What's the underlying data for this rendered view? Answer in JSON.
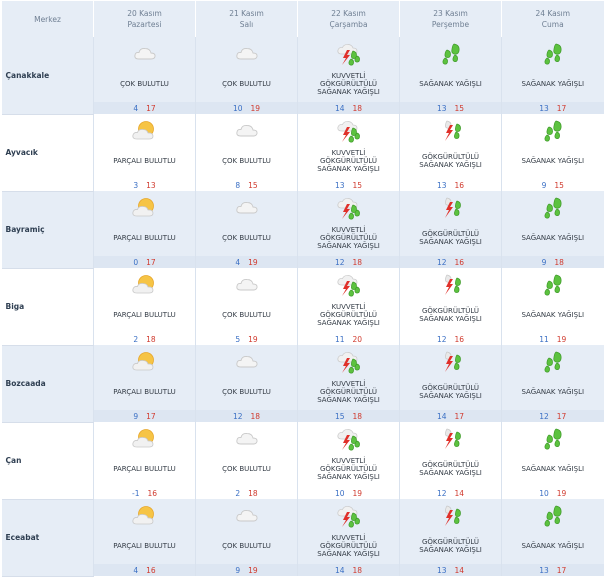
{
  "header": {
    "merkez": "Merkez",
    "days": [
      {
        "date": "20 Kasım",
        "weekday": "Pazartesi"
      },
      {
        "date": "21 Kasım",
        "weekday": "Salı"
      },
      {
        "date": "22 Kasım",
        "weekday": "Çarşamba"
      },
      {
        "date": "23 Kasım",
        "weekday": "Perşembe"
      },
      {
        "date": "24 Kasım",
        "weekday": "Cuma"
      }
    ]
  },
  "cities": [
    {
      "name": "Çanakkale",
      "days": [
        {
          "icon": "cloudy-icon",
          "cond": [
            "ÇOK BULUTLU"
          ],
          "min": "4",
          "max": "17"
        },
        {
          "icon": "cloudy-icon",
          "cond": [
            "ÇOK BULUTLU"
          ],
          "min": "10",
          "max": "19"
        },
        {
          "icon": "strong-thunder-rain-icon",
          "cond": [
            "KUVVETLİ",
            "GÖKGÜRÜLTÜLÜ",
            "SAĞANAK YAĞIŞLI"
          ],
          "min": "14",
          "max": "18"
        },
        {
          "icon": "heavy-rain-icon",
          "cond": [
            "SAĞANAK YAĞIŞLI"
          ],
          "min": "13",
          "max": "15"
        },
        {
          "icon": "heavy-rain-icon",
          "cond": [
            "SAĞANAK YAĞIŞLI"
          ],
          "min": "13",
          "max": "17"
        }
      ]
    },
    {
      "name": "Ayvacık",
      "days": [
        {
          "icon": "partly-cloudy-icon",
          "cond": [
            "PARÇALI BULUTLU"
          ],
          "min": "3",
          "max": "13"
        },
        {
          "icon": "cloudy-icon",
          "cond": [
            "ÇOK BULUTLU"
          ],
          "min": "8",
          "max": "15"
        },
        {
          "icon": "strong-thunder-rain-icon",
          "cond": [
            "KUVVETLİ",
            "GÖKGÜRÜLTÜLÜ",
            "SAĞANAK YAĞIŞLI"
          ],
          "min": "13",
          "max": "15"
        },
        {
          "icon": "thunder-rain-icon",
          "cond": [
            "GÖKGÜRÜLTÜLÜ",
            "SAĞANAK YAĞIŞLI"
          ],
          "min": "13",
          "max": "16"
        },
        {
          "icon": "heavy-rain-icon",
          "cond": [
            "SAĞANAK YAĞIŞLI"
          ],
          "min": "9",
          "max": "15"
        }
      ]
    },
    {
      "name": "Bayramiç",
      "days": [
        {
          "icon": "partly-cloudy-icon",
          "cond": [
            "PARÇALI BULUTLU"
          ],
          "min": "0",
          "max": "17"
        },
        {
          "icon": "cloudy-icon",
          "cond": [
            "ÇOK BULUTLU"
          ],
          "min": "4",
          "max": "19"
        },
        {
          "icon": "strong-thunder-rain-icon",
          "cond": [
            "KUVVETLİ",
            "GÖKGÜRÜLTÜLÜ",
            "SAĞANAK YAĞIŞLI"
          ],
          "min": "12",
          "max": "18"
        },
        {
          "icon": "thunder-rain-icon",
          "cond": [
            "GÖKGÜRÜLTÜLÜ",
            "SAĞANAK YAĞIŞLI"
          ],
          "min": "12",
          "max": "16"
        },
        {
          "icon": "heavy-rain-icon",
          "cond": [
            "SAĞANAK YAĞIŞLI"
          ],
          "min": "9",
          "max": "18"
        }
      ]
    },
    {
      "name": "Biga",
      "days": [
        {
          "icon": "partly-cloudy-icon",
          "cond": [
            "PARÇALI BULUTLU"
          ],
          "min": "2",
          "max": "18"
        },
        {
          "icon": "cloudy-icon",
          "cond": [
            "ÇOK BULUTLU"
          ],
          "min": "5",
          "max": "19"
        },
        {
          "icon": "strong-thunder-rain-icon",
          "cond": [
            "KUVVETLİ",
            "GÖKGÜRÜLTÜLÜ",
            "SAĞANAK YAĞIŞLI"
          ],
          "min": "11",
          "max": "20"
        },
        {
          "icon": "thunder-rain-icon",
          "cond": [
            "GÖKGÜRÜLTÜLÜ",
            "SAĞANAK YAĞIŞLI"
          ],
          "min": "12",
          "max": "16"
        },
        {
          "icon": "heavy-rain-icon",
          "cond": [
            "SAĞANAK YAĞIŞLI"
          ],
          "min": "11",
          "max": "19"
        }
      ]
    },
    {
      "name": "Bozcaada",
      "days": [
        {
          "icon": "partly-cloudy-icon",
          "cond": [
            "PARÇALI BULUTLU"
          ],
          "min": "9",
          "max": "17"
        },
        {
          "icon": "cloudy-icon",
          "cond": [
            "ÇOK BULUTLU"
          ],
          "min": "12",
          "max": "18"
        },
        {
          "icon": "strong-thunder-rain-icon",
          "cond": [
            "KUVVETLİ",
            "GÖKGÜRÜLTÜLÜ",
            "SAĞANAK YAĞIŞLI"
          ],
          "min": "15",
          "max": "18"
        },
        {
          "icon": "thunder-rain-icon",
          "cond": [
            "GÖKGÜRÜLTÜLÜ",
            "SAĞANAK YAĞIŞLI"
          ],
          "min": "14",
          "max": "17"
        },
        {
          "icon": "heavy-rain-icon",
          "cond": [
            "SAĞANAK YAĞIŞLI"
          ],
          "min": "12",
          "max": "17"
        }
      ]
    },
    {
      "name": "Çan",
      "days": [
        {
          "icon": "partly-cloudy-icon",
          "cond": [
            "PARÇALI BULUTLU"
          ],
          "min": "-1",
          "max": "16"
        },
        {
          "icon": "cloudy-icon",
          "cond": [
            "ÇOK BULUTLU"
          ],
          "min": "2",
          "max": "18"
        },
        {
          "icon": "strong-thunder-rain-icon",
          "cond": [
            "KUVVETLİ",
            "GÖKGÜRÜLTÜLÜ",
            "SAĞANAK YAĞIŞLI"
          ],
          "min": "10",
          "max": "19"
        },
        {
          "icon": "thunder-rain-icon",
          "cond": [
            "GÖKGÜRÜLTÜLÜ",
            "SAĞANAK YAĞIŞLI"
          ],
          "min": "12",
          "max": "14"
        },
        {
          "icon": "heavy-rain-icon",
          "cond": [
            "SAĞANAK YAĞIŞLI"
          ],
          "min": "10",
          "max": "19"
        }
      ]
    },
    {
      "name": "Eceabat",
      "days": [
        {
          "icon": "partly-cloudy-icon",
          "cond": [
            "PARÇALI BULUTLU"
          ],
          "min": "4",
          "max": "16"
        },
        {
          "icon": "cloudy-icon",
          "cond": [
            "ÇOK BULUTLU"
          ],
          "min": "9",
          "max": "19"
        },
        {
          "icon": "strong-thunder-rain-icon",
          "cond": [
            "KUVVETLİ",
            "GÖKGÜRÜLTÜLÜ",
            "SAĞANAK YAĞIŞLI"
          ],
          "min": "14",
          "max": "18"
        },
        {
          "icon": "thunder-rain-icon",
          "cond": [
            "GÖKGÜRÜLTÜLÜ",
            "SAĞANAK YAĞIŞLI"
          ],
          "min": "13",
          "max": "14"
        },
        {
          "icon": "heavy-rain-icon",
          "cond": [
            "SAĞANAK YAĞIŞLI"
          ],
          "min": "13",
          "max": "17"
        }
      ]
    }
  ],
  "colors": {
    "header_bg": "#e6edf6",
    "row_shade": "#e6edf6",
    "min_temp": "#3a6fc4",
    "max_temp": "#d03a2e"
  }
}
